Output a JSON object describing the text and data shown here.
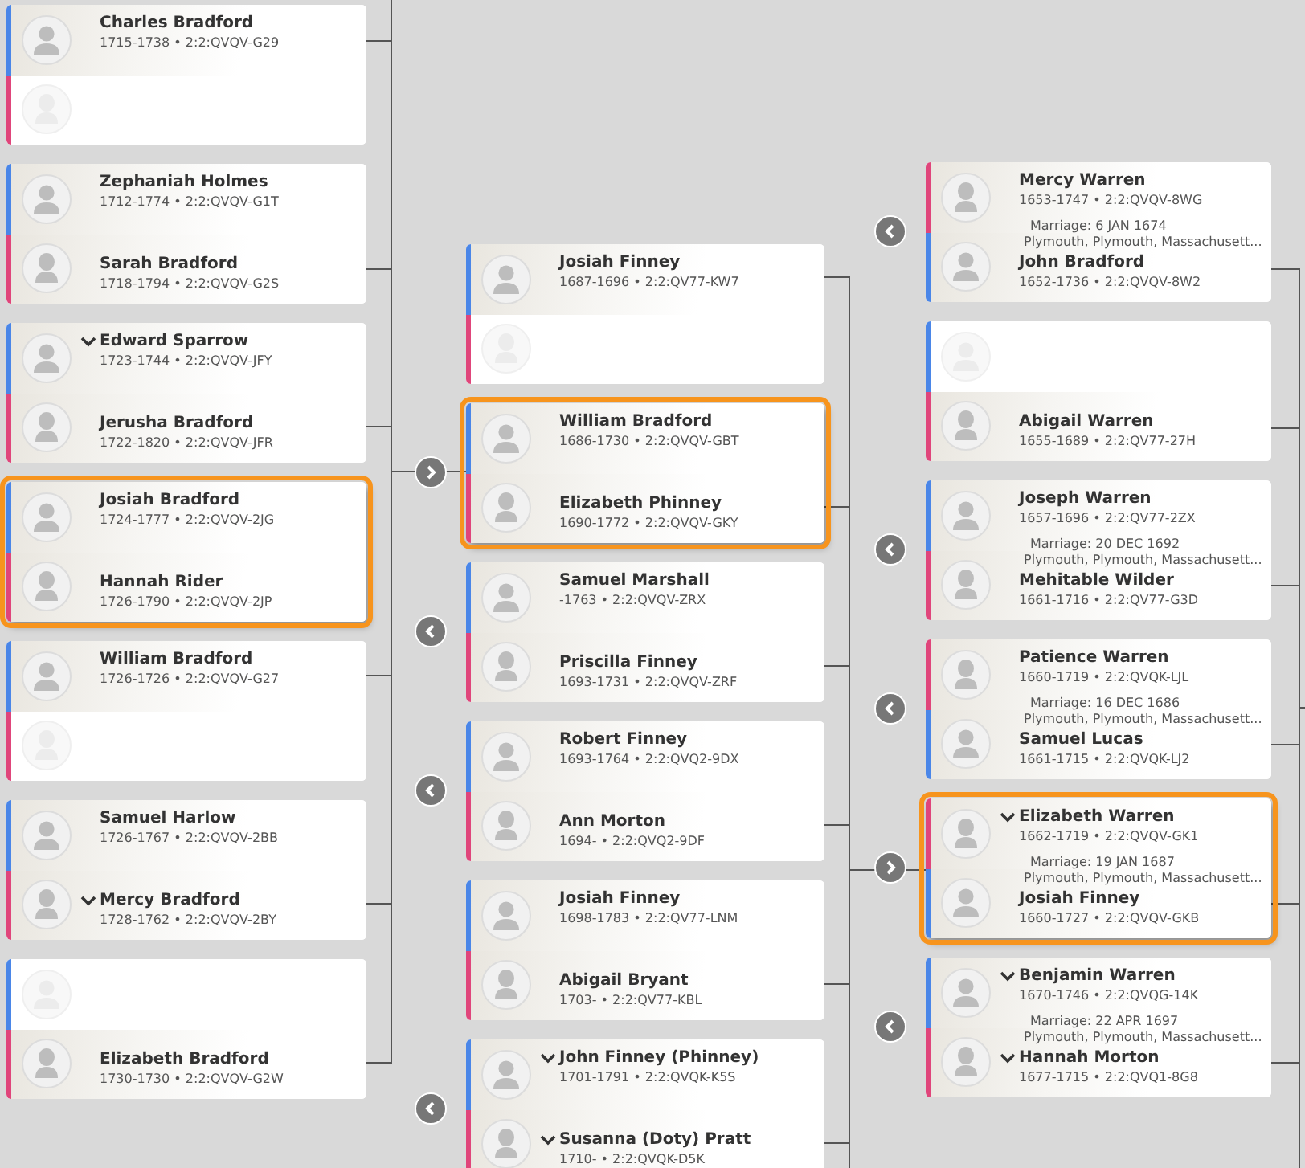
{
  "columns": [
    {
      "cards": [
        {
          "selected": false,
          "people": [
            {
              "kind": "male",
              "empty": false,
              "chevron": false,
              "name": "Charles Bradford",
              "details": "1715-1738 • 2:2:QVQV-G29"
            },
            {
              "kind": "female",
              "empty": true
            }
          ]
        },
        {
          "selected": false,
          "people": [
            {
              "kind": "male",
              "empty": false,
              "chevron": false,
              "name": "Zephaniah Holmes",
              "details": "1712-1774 • 2:2:QVQV-G1T"
            },
            {
              "kind": "female",
              "empty": false,
              "chevron": false,
              "name": "Sarah Bradford",
              "details": "1718-1794 • 2:2:QVQV-G2S"
            }
          ]
        },
        {
          "selected": false,
          "people": [
            {
              "kind": "male",
              "empty": false,
              "chevron": true,
              "name": "Edward Sparrow",
              "details": "1723-1744 • 2:2:QVQV-JFY"
            },
            {
              "kind": "female",
              "empty": false,
              "chevron": false,
              "name": "Jerusha Bradford",
              "details": "1722-1820 • 2:2:QVQV-JFR"
            }
          ]
        },
        {
          "selected": true,
          "people": [
            {
              "kind": "male",
              "empty": false,
              "chevron": false,
              "name": "Josiah Bradford",
              "details": "1724-1777 • 2:2:QVQV-2JG"
            },
            {
              "kind": "female",
              "empty": false,
              "chevron": false,
              "name": "Hannah Rider",
              "details": "1726-1790 • 2:2:QVQV-2JP"
            }
          ]
        },
        {
          "selected": false,
          "people": [
            {
              "kind": "male",
              "empty": false,
              "chevron": false,
              "name": "William Bradford",
              "details": "1726-1726 • 2:2:QVQV-G27"
            },
            {
              "kind": "female",
              "empty": true
            }
          ]
        },
        {
          "selected": false,
          "people": [
            {
              "kind": "male",
              "empty": false,
              "chevron": false,
              "name": "Samuel Harlow",
              "details": "1726-1767 • 2:2:QVQV-2BB"
            },
            {
              "kind": "female",
              "empty": false,
              "chevron": true,
              "name": "Mercy Bradford",
              "details": "1728-1762 • 2:2:QVQV-2BY"
            }
          ]
        },
        {
          "selected": false,
          "people": [
            {
              "kind": "male",
              "empty": true
            },
            {
              "kind": "female",
              "empty": false,
              "chevron": false,
              "name": "Elizabeth Bradford",
              "details": "1730-1730 • 2:2:QVQV-G2W"
            }
          ]
        }
      ]
    },
    {
      "cards": [
        {
          "selected": false,
          "people": [
            {
              "kind": "male",
              "empty": false,
              "chevron": false,
              "name": "Josiah Finney",
              "details": "1687-1696 • 2:2:QV77-KW7"
            },
            {
              "kind": "female",
              "empty": true
            }
          ]
        },
        {
          "selected": true,
          "nav_button": {
            "kind": "forward"
          },
          "people": [
            {
              "kind": "male",
              "empty": false,
              "chevron": false,
              "name": "William Bradford",
              "details": "1686-1730 • 2:2:QVQV-GBT"
            },
            {
              "kind": "female",
              "empty": false,
              "chevron": false,
              "name": "Elizabeth Phinney",
              "details": "1690-1772 • 2:2:QVQV-GKY"
            }
          ]
        },
        {
          "selected": false,
          "nav_button": {
            "kind": "back"
          },
          "people": [
            {
              "kind": "male",
              "empty": false,
              "chevron": false,
              "name": "Samuel Marshall",
              "details": "-1763 • 2:2:QVQV-ZRX"
            },
            {
              "kind": "female",
              "empty": false,
              "chevron": false,
              "name": "Priscilla Finney",
              "details": "1693-1731 • 2:2:QVQV-ZRF"
            }
          ]
        },
        {
          "selected": false,
          "nav_button": {
            "kind": "back"
          },
          "people": [
            {
              "kind": "male",
              "empty": false,
              "chevron": false,
              "name": "Robert Finney",
              "details": "1693-1764 • 2:2:QVQ2-9DX"
            },
            {
              "kind": "female",
              "empty": false,
              "chevron": false,
              "name": "Ann Morton",
              "details": "1694- • 2:2:QVQ2-9DF"
            }
          ]
        },
        {
          "selected": false,
          "people": [
            {
              "kind": "male",
              "empty": false,
              "chevron": false,
              "name": "Josiah Finney",
              "details": "1698-1783 • 2:2:QV77-LNM"
            },
            {
              "kind": "female",
              "empty": false,
              "chevron": false,
              "name": "Abigail Bryant",
              "details": "1703- • 2:2:QV77-KBL"
            }
          ]
        },
        {
          "selected": false,
          "nav_button": {
            "kind": "back"
          },
          "people": [
            {
              "kind": "male",
              "empty": false,
              "chevron": true,
              "name": "John Finney (Phinney)",
              "details": "1701-1791 • 2:2:QVQK-K5S"
            },
            {
              "kind": "female",
              "empty": false,
              "chevron": true,
              "name": "Susanna (Doty) Pratt",
              "details": "1710- • 2:2:QVQK-D5K"
            }
          ]
        }
      ]
    },
    {
      "cards": [
        {
          "selected": false,
          "nav_button": {
            "kind": "back"
          },
          "marriage": {
            "date": "Marriage: 6 JAN 1674",
            "place": "Plymouth, Plymouth, Massachusett..."
          },
          "people": [
            {
              "kind": "female",
              "empty": false,
              "chevron": false,
              "name": "Mercy Warren",
              "details": "1653-1747 • 2:2:QVQV-8WG"
            },
            {
              "kind": "male",
              "empty": false,
              "chevron": false,
              "name": "John Bradford",
              "details": "1652-1736 • 2:2:QVQV-8W2"
            }
          ]
        },
        {
          "selected": false,
          "people": [
            {
              "kind": "male",
              "empty": true
            },
            {
              "kind": "female",
              "empty": false,
              "chevron": false,
              "name": "Abigail Warren",
              "details": "1655-1689 • 2:2:QV77-27H"
            }
          ]
        },
        {
          "selected": false,
          "nav_button": {
            "kind": "back"
          },
          "marriage": {
            "date": "Marriage: 20 DEC 1692",
            "place": "Plymouth, Plymouth, Massachusett..."
          },
          "people": [
            {
              "kind": "male",
              "empty": false,
              "chevron": false,
              "name": "Joseph Warren",
              "details": "1657-1696 • 2:2:QV77-2ZX"
            },
            {
              "kind": "female",
              "empty": false,
              "chevron": false,
              "name": "Mehitable Wilder",
              "details": "1661-1716 • 2:2:QV77-G3D"
            }
          ]
        },
        {
          "selected": false,
          "nav_button": {
            "kind": "back"
          },
          "marriage": {
            "date": "Marriage: 16 DEC 1686",
            "place": "Plymouth, Plymouth, Massachusett..."
          },
          "people": [
            {
              "kind": "female",
              "empty": false,
              "chevron": false,
              "name": "Patience Warren",
              "details": "1660-1719 • 2:2:QVQK-LJL"
            },
            {
              "kind": "male",
              "empty": false,
              "chevron": false,
              "name": "Samuel Lucas",
              "details": "1661-1715 • 2:2:QVQK-LJ2"
            }
          ]
        },
        {
          "selected": true,
          "nav_button": {
            "kind": "forward"
          },
          "marriage": {
            "date": "Marriage: 19 JAN 1687",
            "place": "Plymouth, Plymouth, Massachusett..."
          },
          "people": [
            {
              "kind": "female",
              "empty": false,
              "chevron": true,
              "name": "Elizabeth Warren",
              "details": "1662-1719 • 2:2:QVQV-GK1"
            },
            {
              "kind": "male",
              "empty": false,
              "chevron": false,
              "name": "Josiah Finney",
              "details": "1660-1727 • 2:2:QVQV-GKB"
            }
          ]
        },
        {
          "selected": false,
          "nav_button": {
            "kind": "back"
          },
          "marriage": {
            "date": "Marriage: 22 APR 1697",
            "place": "Plymouth, Plymouth, Massachusett..."
          },
          "people": [
            {
              "kind": "male",
              "empty": false,
              "chevron": true,
              "name": "Benjamin Warren",
              "details": "1670-1746 • 2:2:QVQG-14K"
            },
            {
              "kind": "female",
              "empty": false,
              "chevron": true,
              "name": "Hannah Morton",
              "details": "1677-1715 • 2:2:QVQ1-8G8"
            }
          ]
        }
      ]
    }
  ]
}
